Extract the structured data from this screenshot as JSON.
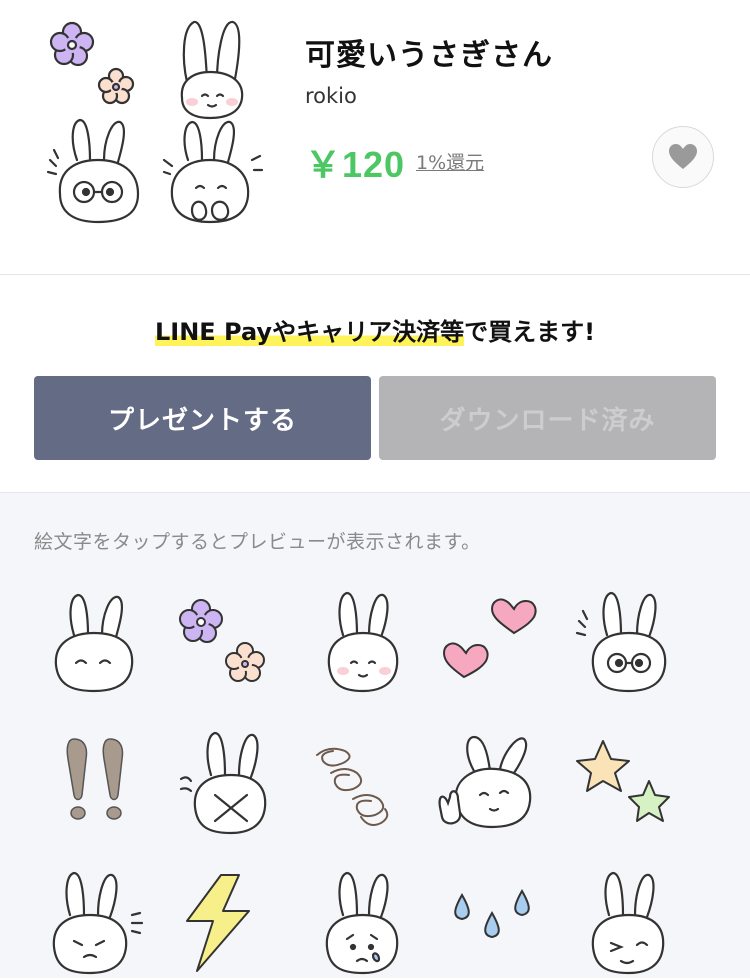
{
  "product": {
    "title": "可愛いうさぎさん",
    "author": "rokio",
    "price": "￥120",
    "cashback": "1%還元"
  },
  "favorite": {
    "icon": "heart-icon"
  },
  "purchase": {
    "promo_highlight": "LINE Payやキャリア決済等",
    "promo_rest": "で買えます!",
    "present_label": "プレゼントする",
    "download_label": "ダウンロード済み"
  },
  "preview": {
    "hint": "絵文字をタップするとプレビューが表示されます。",
    "emoji": [
      "rabbit-smile",
      "flowers",
      "rabbit-blush",
      "hearts",
      "rabbit-glasses",
      "exclamation-marks",
      "rabbit-crossed",
      "spiral-dizzy",
      "rabbit-peace",
      "stars",
      "rabbit-pout",
      "lightning",
      "rabbit-tear",
      "water-drops",
      "rabbit-wink"
    ]
  },
  "colors": {
    "price": "#4cc764",
    "present_button": "#636b85",
    "download_button": "#b4b4b6",
    "highlight": "#fff35a"
  }
}
